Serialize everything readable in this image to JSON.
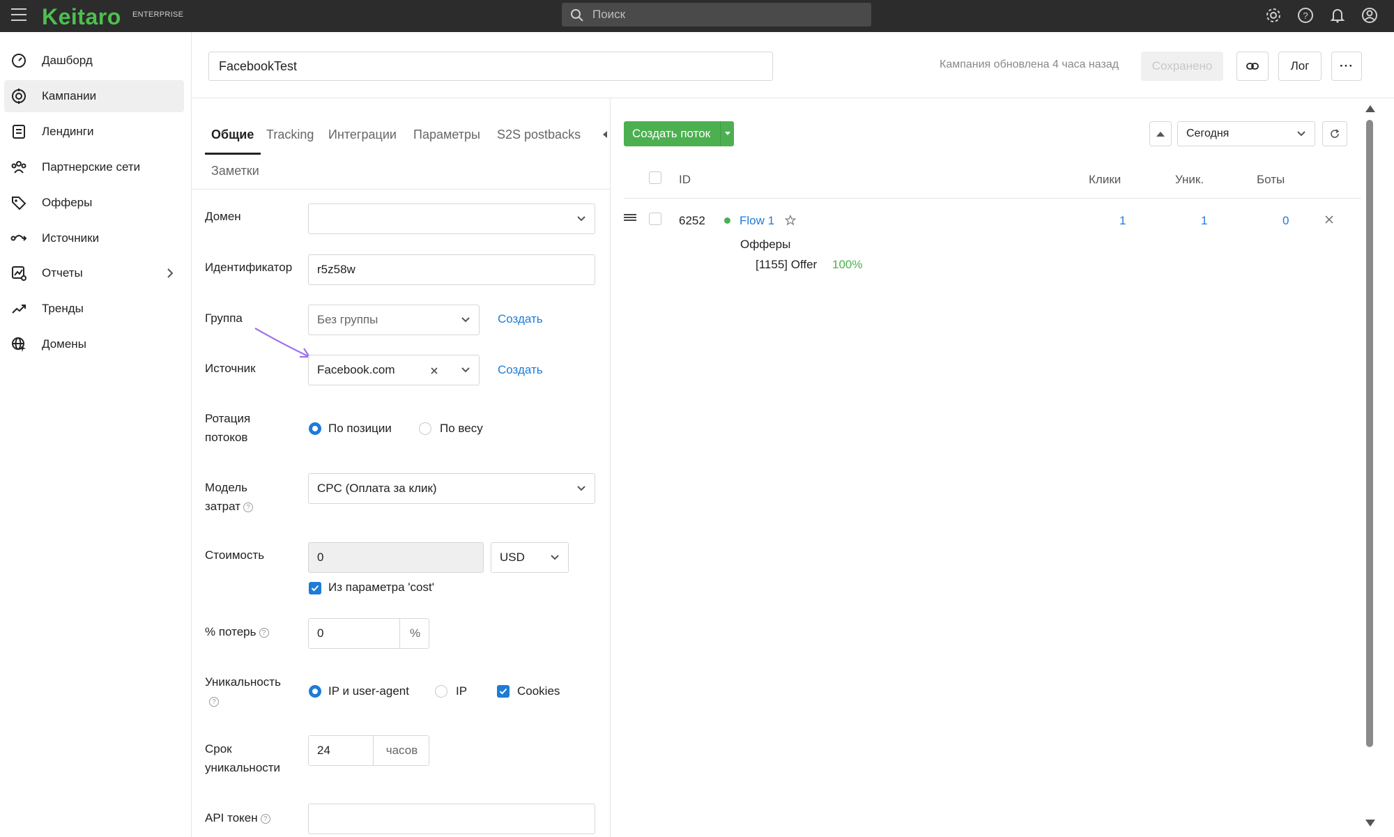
{
  "topbar": {
    "logo": "Keitaro",
    "edition": "ENTERPRISE",
    "search_placeholder": "Поиск"
  },
  "sidebar": {
    "items": [
      {
        "label": "Дашборд",
        "icon": "dashboard-icon"
      },
      {
        "label": "Кампании",
        "icon": "campaigns-icon",
        "active": true
      },
      {
        "label": "Лендинги",
        "icon": "landings-icon"
      },
      {
        "label": "Партнерские сети",
        "icon": "affiliate-networks-icon"
      },
      {
        "label": "Офферы",
        "icon": "offers-icon"
      },
      {
        "label": "Источники",
        "icon": "sources-icon"
      },
      {
        "label": "Отчеты",
        "icon": "reports-icon"
      },
      {
        "label": "Тренды",
        "icon": "trends-icon"
      },
      {
        "label": "Домены",
        "icon": "domains-icon"
      }
    ]
  },
  "header": {
    "campaign_name": "FacebookTest",
    "updated_text": "Кампания обновлена 4 часа назад",
    "saved_label": "Сохранено",
    "log_label": "Лог",
    "more_label": "···"
  },
  "tabs": [
    "Общие",
    "Tracking",
    "Интеграции",
    "Параметры",
    "S2S postbacks",
    "Заметки"
  ],
  "form": {
    "domain_label": "Домен",
    "domain_value": "",
    "identifier_label": "Идентификатор",
    "identifier_value": "r5z58w",
    "group_label": "Группа",
    "group_value": "Без группы",
    "create_label": "Создать",
    "source_label": "Источник",
    "source_value": "Facebook.com",
    "rotation_label_1": "Ротация",
    "rotation_label_2": "потоков",
    "rotation_opt_position": "По позиции",
    "rotation_opt_weight": "По весу",
    "cost_model_label_1": "Модель",
    "cost_model_label_2": "затрат",
    "cost_model_value": "CPC (Оплата за клик)",
    "cost_label": "Стоимость",
    "cost_value": "0",
    "currency_value": "USD",
    "from_param_label": "Из параметра 'cost'",
    "loss_label": "% потерь",
    "loss_value": "0",
    "loss_unit": "%",
    "uniq_label": "Уникальность",
    "uniq_opt_ipua": "IP и user-agent",
    "uniq_opt_ip": "IP",
    "uniq_opt_cookies": "Cookies",
    "uniq_term_label_1": "Срок",
    "uniq_term_label_2": "уникальности",
    "uniq_term_value": "24",
    "uniq_term_unit": "часов",
    "api_token_label": "API токен",
    "api_token_value": ""
  },
  "flows": {
    "create_label": "Создать поток",
    "period_value": "Сегодня",
    "columns": {
      "id": "ID",
      "clicks": "Клики",
      "unique": "Уник.",
      "bots": "Боты"
    },
    "rows": [
      {
        "id": "6252",
        "name": "Flow 1",
        "status_color": "#4cb050",
        "clicks": "1",
        "unique": "1",
        "bots": "0",
        "offers_label": "Офферы",
        "offer": "[1155] Offer",
        "offer_share": "100%"
      }
    ]
  },
  "colors": {
    "accent_blue": "#1e7bd7",
    "green": "#4cb050",
    "topbar": "#2c2c2c",
    "annotation_arrow": "#a070e8"
  }
}
